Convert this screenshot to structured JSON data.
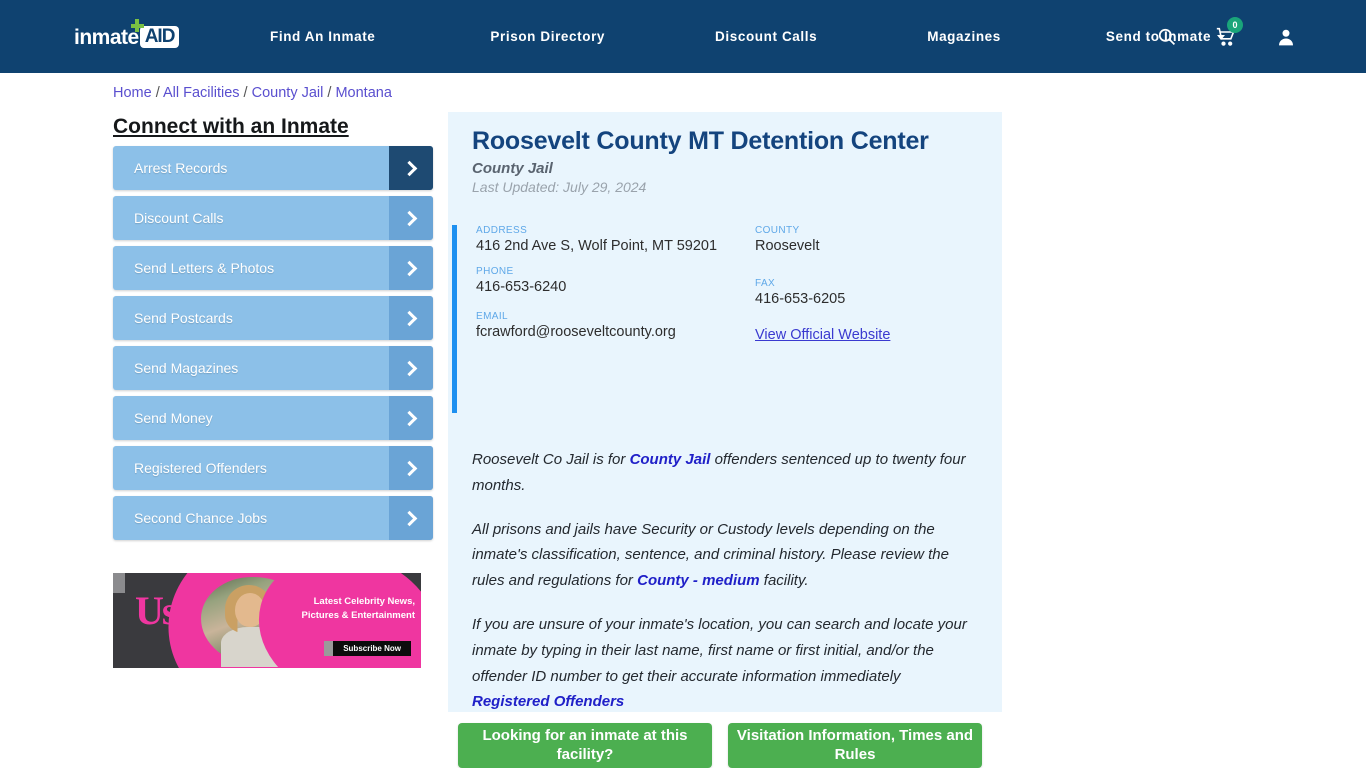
{
  "header": {
    "logo": {
      "text": "inmate",
      "badge": "AID",
      "plus_icon": "green-plus"
    },
    "nav": [
      {
        "label": "Find An Inmate"
      },
      {
        "label": "Prison Directory"
      },
      {
        "label": "Discount Calls"
      },
      {
        "label": "Magazines"
      },
      {
        "label": "Send to Inmate",
        "has_caret": true
      }
    ],
    "icons": {
      "search": "search-icon",
      "cart": "cart-icon",
      "cart_count": "0",
      "account": "user-icon"
    },
    "bg_color": "#0f4270"
  },
  "breadcrumb": {
    "items": [
      "Home",
      "All Facilities",
      "County Jail",
      "Montana"
    ],
    "separator": "/",
    "link_color": "#5a4fcf"
  },
  "sidebar": {
    "title": "Connect with an Inmate",
    "items": [
      {
        "label": "Arrest Records",
        "active": true
      },
      {
        "label": "Discount Calls",
        "active": false
      },
      {
        "label": "Send Letters & Photos",
        "active": false
      },
      {
        "label": "Send Postcards",
        "active": false
      },
      {
        "label": "Send Magazines",
        "active": false
      },
      {
        "label": "Send Money",
        "active": false
      },
      {
        "label": "Registered Offenders",
        "active": false
      },
      {
        "label": "Second Chance Jobs",
        "active": false
      }
    ]
  },
  "ad": {
    "brand": "Us",
    "headline": "Latest Celebrity News, Pictures & Entertainment",
    "cta": "Subscribe Now"
  },
  "facility": {
    "title": "Roosevelt County MT Detention Center",
    "type": "County Jail",
    "last_updated": "Last Updated: July 29, 2024",
    "accent_color": "#1e90f0",
    "fields": {
      "address_label": "ADDRESS",
      "address_value": "416 2nd Ave S, Wolf Point, MT 59201",
      "county_label": "COUNTY",
      "county_value": "Roosevelt",
      "phone_label": "PHONE",
      "phone_value": "416-653-6240",
      "fax_label": "FAX",
      "fax_value": "416-653-6205",
      "email_label": "EMAIL",
      "email_value": "fcrawford@rooseveltcounty.org",
      "website_link": "View Official Website"
    },
    "paragraphs": {
      "p1_a": "Roosevelt Co Jail is for ",
      "p1_b": "County Jail",
      "p1_c": " offenders sentenced up to twenty four months.",
      "p2_a": "All prisons and jails have Security or Custody levels depending on the inmate's classification, sentence, and criminal history. Please review the rules and regulations for ",
      "p2_b": "County - medium",
      "p2_c": " facility.",
      "p3_a": "If you are unsure of your inmate's location, you can search and locate your inmate by typing in their last name, first name or first initial, and/or the offender ID number to get their accurate information immediately ",
      "p3_b": "Registered Offenders"
    }
  },
  "actions": {
    "find_inmate": "Looking for an inmate at this facility?",
    "visitation": "Visitation Information, Times and Rules",
    "button_color": "#4caf50"
  }
}
